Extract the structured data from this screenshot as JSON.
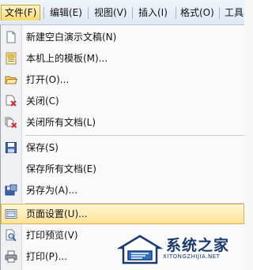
{
  "menubar": {
    "file": "文件(F)",
    "edit": "编辑(E)",
    "view": "视图(V)",
    "insert": "插入(I)",
    "format": "格式(O)",
    "tools": "工具"
  },
  "file_menu": {
    "new_blank": "新建空白演示文稿(N)",
    "local_templates": "本机上的模板(M)...",
    "open": "打开(O)...",
    "close": "关闭(C)",
    "close_all": "关闭所有文档(L)",
    "save": "保存(S)",
    "save_all": "保存所有文档(E)",
    "save_as": "另存为(A)...",
    "page_setup": "页面设置(U)...",
    "print_preview": "打印预览(V)",
    "print": "打印(P)..."
  },
  "watermark": {
    "title": "系统之家",
    "url": "XITONGZHIJIA.NET"
  },
  "colors": {
    "highlight": "#ffe29a",
    "menubar": "#dfe8f3",
    "watermark": "#1a3a6e"
  }
}
